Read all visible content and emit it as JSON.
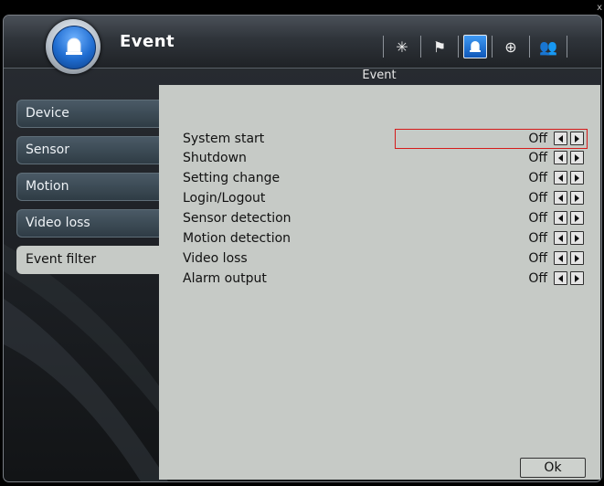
{
  "window": {
    "close_label": "x"
  },
  "header": {
    "title": "Event",
    "subtitle": "Event",
    "toolbar": [
      {
        "icon": "spark-icon",
        "glyph": "✳"
      },
      {
        "icon": "flag-icon",
        "glyph": "⚑"
      },
      {
        "icon": "alarm-light-icon",
        "glyph": ""
      },
      {
        "icon": "globe-icon",
        "glyph": "⊕"
      },
      {
        "icon": "users-icon",
        "glyph": "👥"
      }
    ],
    "active_toolbar_icon": "alarm-light-icon"
  },
  "sidebar": {
    "items": [
      {
        "label": "Device"
      },
      {
        "label": "Sensor"
      },
      {
        "label": "Motion"
      },
      {
        "label": "Video loss"
      },
      {
        "label": "Event filter"
      }
    ],
    "selected": "Event filter"
  },
  "event_filter": {
    "rows": [
      {
        "label": "System start",
        "value": "Off"
      },
      {
        "label": "Shutdown",
        "value": "Off"
      },
      {
        "label": "Setting change",
        "value": "Off"
      },
      {
        "label": "Login/Logout",
        "value": "Off"
      },
      {
        "label": "Sensor detection",
        "value": "Off"
      },
      {
        "label": "Motion detection",
        "value": "Off"
      },
      {
        "label": "Video loss",
        "value": "Off"
      },
      {
        "label": "Alarm output",
        "value": "Off"
      }
    ],
    "highlighted_row": "System start"
  },
  "footer": {
    "ok_label": "Ok"
  },
  "colors": {
    "accent": "#1f6cd0",
    "panel": "#c6cac6",
    "highlight": "#d51b1b"
  }
}
